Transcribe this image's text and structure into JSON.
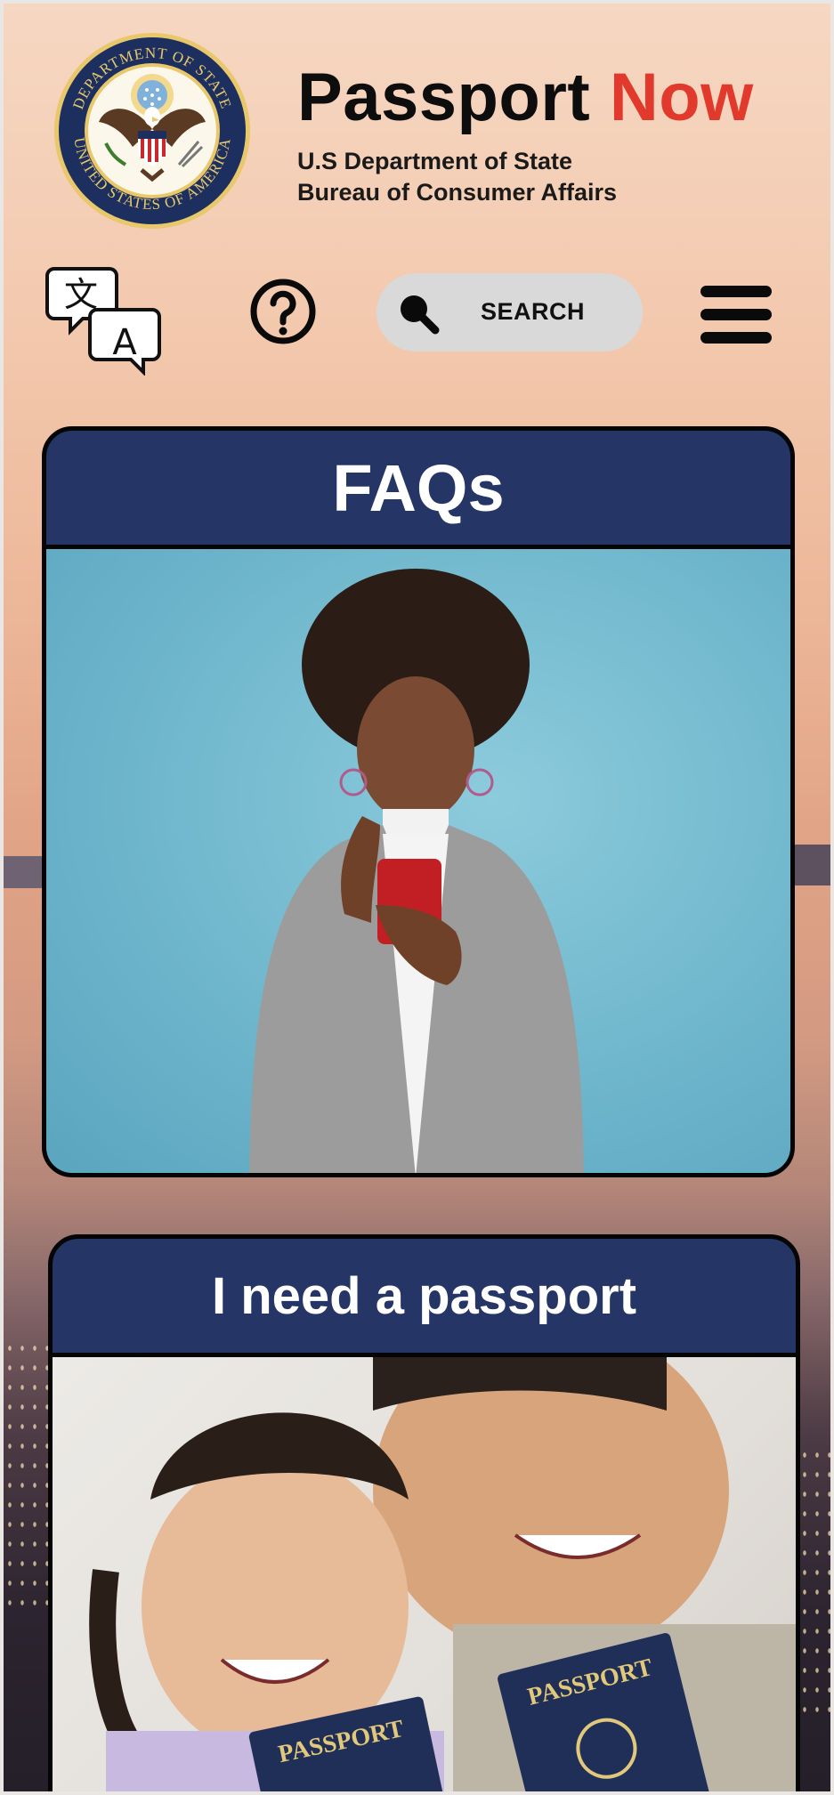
{
  "header": {
    "seal_alt": "Department of State seal",
    "seal_ring_text": "DEPARTMENT OF STATE • UNITED STATES OF AMERICA",
    "brand_word": "Passport",
    "brand_accent": "Now",
    "sub_line1": "U.S Department of State",
    "sub_line2": "Bureau of Consumer Affairs"
  },
  "toolbar": {
    "language_icon": "translate-icon",
    "language_glyph_1": "文",
    "language_glyph_2": "A",
    "help_icon": "question-circle-icon",
    "search_icon": "magnifier-icon",
    "search_label": "SEARCH",
    "menu_icon": "hamburger-menu-icon"
  },
  "cards": [
    {
      "title": "FAQs",
      "image": "woman looking at phone"
    },
    {
      "title": "I need a passport",
      "image": "family holding passports"
    }
  ],
  "passport_cover_text": "PASSPORT",
  "colors": {
    "brand_accent": "#e1392b",
    "card_header": "#243566",
    "search_pill": "#d9d9d9",
    "text_dark": "#0d0d0d"
  }
}
